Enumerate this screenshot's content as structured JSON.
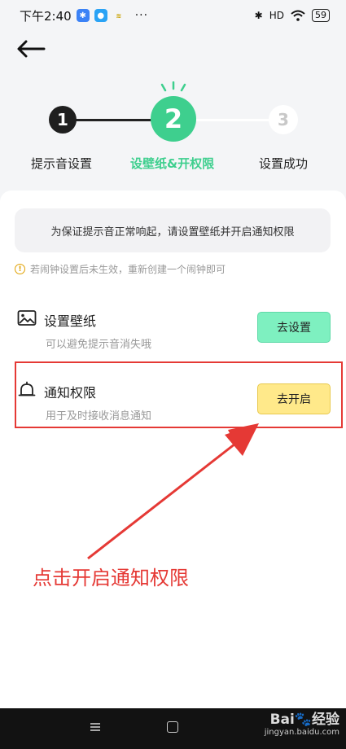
{
  "status_bar": {
    "time": "下午2:40",
    "signal_label": "HD",
    "battery": "59",
    "more": "···"
  },
  "stepper": {
    "steps": [
      {
        "number": "1",
        "label": "提示音设置"
      },
      {
        "number": "2",
        "label": "设壁纸&开权限"
      },
      {
        "number": "3",
        "label": "设置成功"
      }
    ],
    "active_color": "#3ecf8e"
  },
  "card": {
    "notice": "为保证提示音正常响起，请设置壁纸并开启通知权限",
    "tip": "若闹钟设置后未生效，重新创建一个闹钟即可",
    "items": [
      {
        "title": "设置壁纸",
        "subtitle": "可以避免提示音消失哦",
        "button": "去设置",
        "icon": "image-icon"
      },
      {
        "title": "通知权限",
        "subtitle": "用于及时接收消息通知",
        "button": "去开启",
        "icon": "bell-icon"
      }
    ]
  },
  "annotation": {
    "text": "点击开启通知权限",
    "color": "#e53935"
  },
  "watermark": {
    "brand": "Bai🐾经验",
    "url": "jingyan.baidu.com"
  }
}
